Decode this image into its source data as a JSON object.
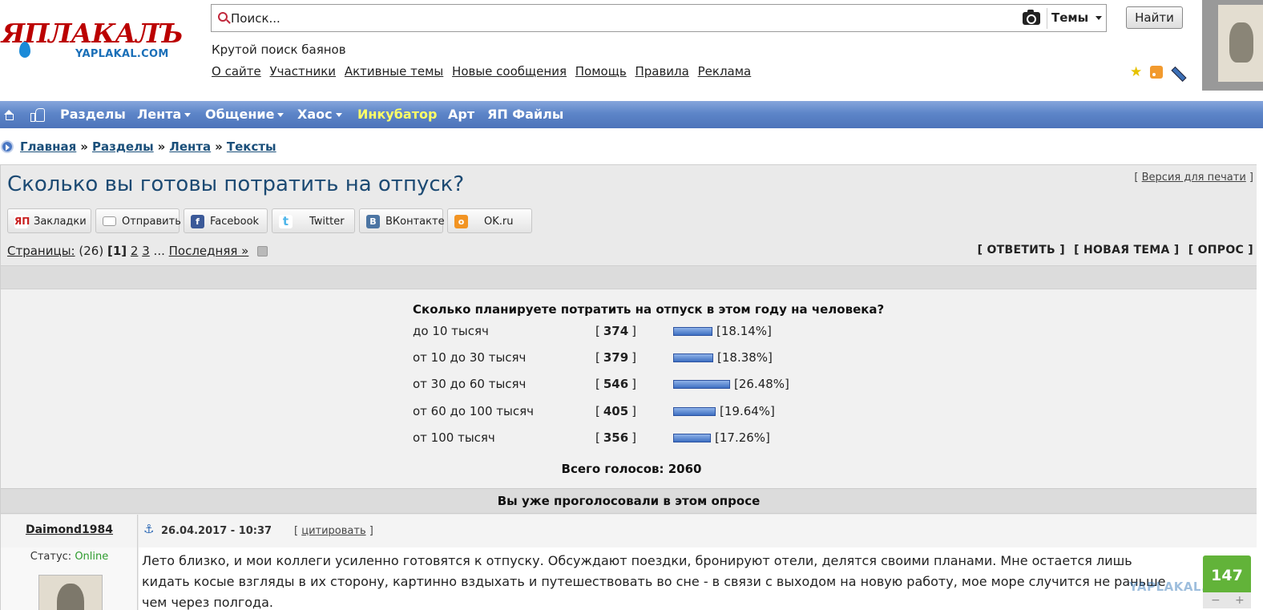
{
  "brand": {
    "logo_text": "ЯПЛАКАЛЪ",
    "logo_subtext": "YAPLAKAL.COM"
  },
  "search": {
    "placeholder": "Поиск...",
    "scope": "Темы",
    "button": "Найти"
  },
  "tagline": "Крутой поиск баянов",
  "topnav": [
    "О сайте",
    "Участники",
    "Активные темы",
    "Новые сообщения",
    "Помощь",
    "Правила",
    "Реклама"
  ],
  "header_icons": [
    "star-icon",
    "rss-icon",
    "pencil-icon"
  ],
  "navbar": {
    "items": [
      {
        "label": "Разделы",
        "dropdown": false
      },
      {
        "label": "Лента",
        "dropdown": true
      },
      {
        "label": "Общение",
        "dropdown": true
      },
      {
        "label": "Хаос",
        "dropdown": true
      },
      {
        "label": "Инкубатор",
        "dropdown": false,
        "color": "#ffff66"
      },
      {
        "label": "Арт",
        "dropdown": false
      },
      {
        "label": "ЯП Файлы",
        "dropdown": false
      }
    ],
    "bar_color": "#5d85c8"
  },
  "breadcrumb": {
    "items": [
      "Главная",
      "Разделы",
      "Лента",
      "Тексты"
    ],
    "separator": "»"
  },
  "topic": {
    "title": "Сколько вы готовы потратить на отпуск?",
    "print_link": "Версия для печати",
    "share": [
      {
        "label": "Закладки",
        "icon": "yap-icon",
        "color": "#c81e1e"
      },
      {
        "label": "Отправить",
        "icon": "mail-icon",
        "color": "#9a9a9a"
      },
      {
        "label": "Facebook",
        "icon": "facebook-icon",
        "color": "#3b5998"
      },
      {
        "label": "Twitter",
        "icon": "twitter-icon",
        "color": "#4fb6ea"
      },
      {
        "label": "ВКонтакте",
        "icon": "vk-icon",
        "color": "#4c75a3"
      },
      {
        "label": "OK.ru",
        "icon": "ok-icon",
        "color": "#f29423"
      }
    ],
    "pager": {
      "label": "Страницы:",
      "total": "(26)",
      "current": "1",
      "pages": [
        "2",
        "3"
      ],
      "ellipsis": "...",
      "last": "Последняя »"
    },
    "actions": [
      "ОТВЕТИТЬ",
      "НОВАЯ ТЕМА",
      "ОПРОС"
    ]
  },
  "poll": {
    "question": "Сколько планируете потратить на отпуск в этом году на человека?",
    "options": [
      {
        "label": "до 10 тысяч",
        "votes": "374",
        "percent": "[18.14%]",
        "share": 18.14
      },
      {
        "label": "от 10 до 30 тысяч",
        "votes": "379",
        "percent": "[18.38%]",
        "share": 18.38
      },
      {
        "label": "от 30 до 60 тысяч",
        "votes": "546",
        "percent": "[26.48%]",
        "share": 26.48
      },
      {
        "label": "от 60 до 100 тысяч",
        "votes": "405",
        "percent": "[19.64%]",
        "share": 19.64
      },
      {
        "label": "от 100 тысяч",
        "votes": "356",
        "percent": "[17.26%]",
        "share": 17.26
      }
    ],
    "total": "Всего голосов: 2060",
    "voted_message": "Вы уже проголосовали в этом опросе",
    "bar_color": "#3e6fc2"
  },
  "post": {
    "author": "Daimond1984",
    "date": "26.04.2017 - 10:37",
    "quote": "цитировать",
    "status_label": "Статус:",
    "status_value": "Online",
    "status_color": "#2e9b2e",
    "text": "Лето близко, и мои коллеги усиленно готовятся к отпуску. Обсуждают поездки, бронируют отели, делятся своими планами. Мне остается лишь кидать косые взгляды в их сторону, картинно вздыхать и путешествовать во сне - в связи с выходом на новую работу, мое море случится не раньше чем через полгода.",
    "rating": "147",
    "rating_color": "#62b339",
    "rating_minus": "−",
    "rating_plus": "+",
    "watermark": "YAPLAKAL.COM"
  }
}
